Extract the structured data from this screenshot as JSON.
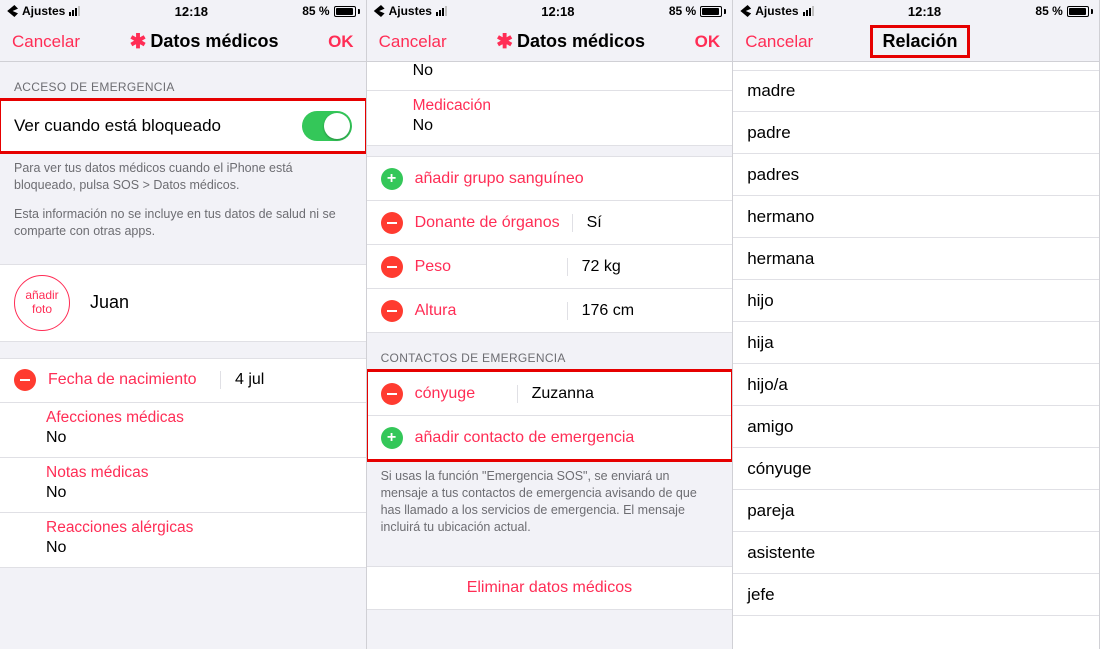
{
  "status": {
    "back_app": "Ajustes",
    "time": "12:18",
    "battery_pct": "85 %"
  },
  "s1": {
    "cancel": "Cancelar",
    "title": "Datos médicos",
    "ok": "OK",
    "em_header": "ACCESO DE EMERGENCIA",
    "toggle_label": "Ver cuando está bloqueado",
    "note1": "Para ver tus datos médicos cuando el iPhone está bloqueado, pulsa SOS > Datos médicos.",
    "note2": "Esta información no se incluye en tus datos de salud ni se comparte con otras apps.",
    "add_photo": "añadir\nfoto",
    "name": "Juan",
    "dob_label": "Fecha de nacimiento",
    "dob_value": "4 jul",
    "cond_label": "Afecciones médicas",
    "cond_value": "No",
    "notes_label": "Notas médicas",
    "notes_value": "No",
    "allergy_label": "Reacciones alérgicas",
    "allergy_value": "No"
  },
  "s2": {
    "cancel": "Cancelar",
    "title": "Datos médicos",
    "ok": "OK",
    "top_value": "No",
    "med_label": "Medicación",
    "med_value": "No",
    "add_blood": "añadir grupo sanguíneo",
    "donor_label": "Donante de órganos",
    "donor_value": "Sí",
    "weight_label": "Peso",
    "weight_value": "72 kg",
    "height_label": "Altura",
    "height_value": "176 cm",
    "em_header": "CONTACTOS DE EMERGENCIA",
    "contact_rel": "cónyuge",
    "contact_name": "Zuzanna",
    "add_contact": "añadir contacto de emergencia",
    "em_note": "Si usas la función \"Emergencia SOS\", se enviará un mensaje a tus contactos de emergencia avisando de que has llamado a los servicios de emergencia. El mensaje incluirá tu ubicación actual.",
    "delete": "Eliminar datos médicos"
  },
  "s3": {
    "cancel": "Cancelar",
    "title": "Relación",
    "items": [
      "madre",
      "padre",
      "padres",
      "hermano",
      "hermana",
      "hijo",
      "hija",
      "hijo/a",
      "amigo",
      "cónyuge",
      "pareja",
      "asistente",
      "jefe"
    ]
  }
}
